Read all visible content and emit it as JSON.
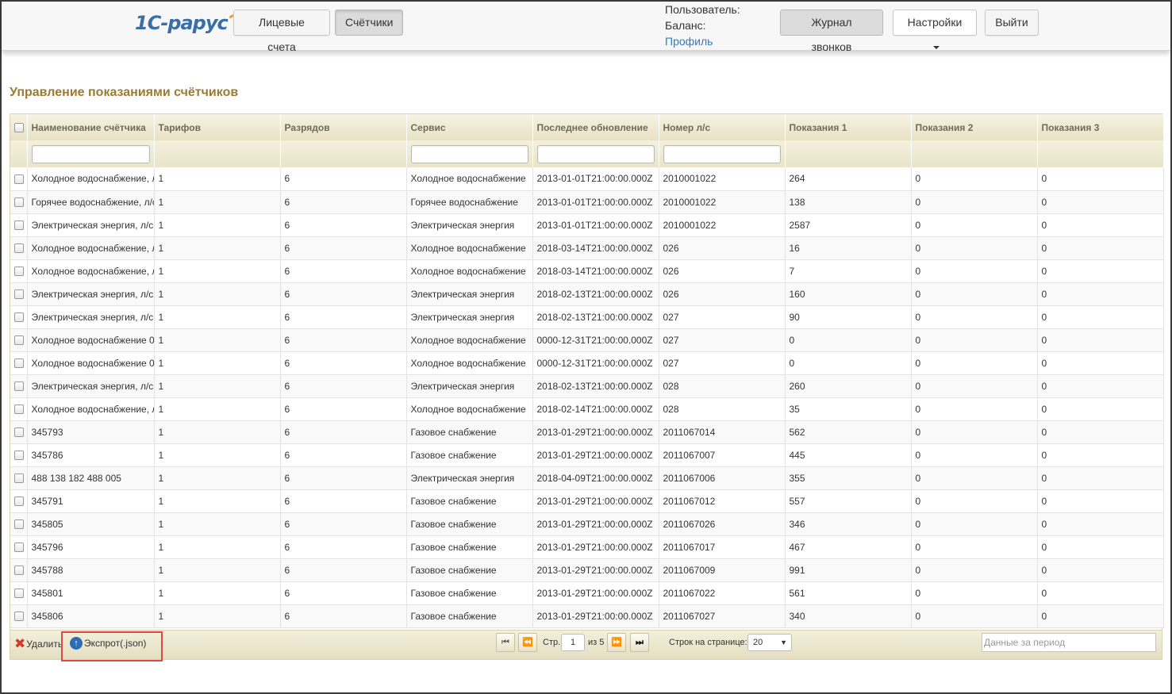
{
  "header": {
    "logo_text": "1С-рарус",
    "nav": [
      {
        "label": "Лицевые счета",
        "active": false
      },
      {
        "label": "Счётчики",
        "active": true
      }
    ],
    "user_label": "Пользователь:",
    "balance_label": "Баланс:",
    "profile_link": "Профиль",
    "call_log": "Журнал звонков",
    "settings": "Настройки",
    "logout": "Выйти"
  },
  "page": {
    "title": "Управление показаниями счётчиков"
  },
  "table": {
    "columns": [
      "Наименование счётчика",
      "Тарифов",
      "Разрядов",
      "Сервис",
      "Последнее обновление",
      "Номер л/с",
      "Показания 1",
      "Показания 2",
      "Показания 3"
    ],
    "rows": [
      [
        "Холодное водоснабжение, л/с",
        "1",
        "6",
        "Холодное водоснабжение",
        "2013-01-01T21:00:00.000Z",
        "2010001022",
        "264",
        "0",
        "0"
      ],
      [
        "Горячее водоснабжение, л/с",
        "1",
        "6",
        "Горячее водоснабжение",
        "2013-01-01T21:00:00.000Z",
        "2010001022",
        "138",
        "0",
        "0"
      ],
      [
        "Электрическая энергия, л/с",
        "1",
        "6",
        "Электрическая энергия",
        "2013-01-01T21:00:00.000Z",
        "2010001022",
        "2587",
        "0",
        "0"
      ],
      [
        "Холодное водоснабжение, л/с",
        "1",
        "6",
        "Холодное водоснабжение",
        "2018-03-14T21:00:00.000Z",
        "026",
        "16",
        "0",
        "0"
      ],
      [
        "Холодное водоснабжение, л/с",
        "1",
        "6",
        "Холодное водоснабжение",
        "2018-03-14T21:00:00.000Z",
        "026",
        "7",
        "0",
        "0"
      ],
      [
        "Электрическая энергия, л/с",
        "1",
        "6",
        "Электрическая энергия",
        "2018-02-13T21:00:00.000Z",
        "026",
        "160",
        "0",
        "0"
      ],
      [
        "Электрическая энергия, л/с",
        "1",
        "6",
        "Электрическая энергия",
        "2018-02-13T21:00:00.000Z",
        "027",
        "90",
        "0",
        "0"
      ],
      [
        "Холодное водоснабжение 0",
        "1",
        "6",
        "Холодное водоснабжение",
        "0000-12-31T21:00:00.000Z",
        "027",
        "0",
        "0",
        "0"
      ],
      [
        "Холодное водоснабжение 0",
        "1",
        "6",
        "Холодное водоснабжение",
        "0000-12-31T21:00:00.000Z",
        "027",
        "0",
        "0",
        "0"
      ],
      [
        "Электрическая энергия, л/с",
        "1",
        "6",
        "Электрическая энергия",
        "2018-02-13T21:00:00.000Z",
        "028",
        "260",
        "0",
        "0"
      ],
      [
        "Холодное водоснабжение, л/с",
        "1",
        "6",
        "Холодное водоснабжение",
        "2018-02-14T21:00:00.000Z",
        "028",
        "35",
        "0",
        "0"
      ],
      [
        "345793",
        "1",
        "6",
        "Газовое снабжение",
        "2013-01-29T21:00:00.000Z",
        "2011067014",
        "562",
        "0",
        "0"
      ],
      [
        "345786",
        "1",
        "6",
        "Газовое снабжение",
        "2013-01-29T21:00:00.000Z",
        "2011067007",
        "445",
        "0",
        "0"
      ],
      [
        "488 138 182 488 005",
        "1",
        "6",
        "Электрическая энергия",
        "2018-04-09T21:00:00.000Z",
        "2011067006",
        "355",
        "0",
        "0"
      ],
      [
        "345791",
        "1",
        "6",
        "Газовое снабжение",
        "2013-01-29T21:00:00.000Z",
        "2011067012",
        "557",
        "0",
        "0"
      ],
      [
        "345805",
        "1",
        "6",
        "Газовое снабжение",
        "2013-01-29T21:00:00.000Z",
        "2011067026",
        "346",
        "0",
        "0"
      ],
      [
        "345796",
        "1",
        "6",
        "Газовое снабжение",
        "2013-01-29T21:00:00.000Z",
        "2011067017",
        "467",
        "0",
        "0"
      ],
      [
        "345788",
        "1",
        "6",
        "Газовое снабжение",
        "2013-01-29T21:00:00.000Z",
        "2011067009",
        "991",
        "0",
        "0"
      ],
      [
        "345801",
        "1",
        "6",
        "Газовое снабжение",
        "2013-01-29T21:00:00.000Z",
        "2011067022",
        "561",
        "0",
        "0"
      ],
      [
        "345806",
        "1",
        "6",
        "Газовое снабжение",
        "2013-01-29T21:00:00.000Z",
        "2011067027",
        "340",
        "0",
        "0"
      ]
    ]
  },
  "footer": {
    "delete_label": "Удалить",
    "export_label": "Экспрот(.json)",
    "page_label": "Стр.",
    "page_current": "1",
    "page_of": "из 5",
    "rows_per_page_label": "Строк на странице:",
    "rows_per_page_value": "20",
    "period_placeholder": "Данные за период"
  },
  "colors": {
    "title": "#9b7b34",
    "link": "#3a78b5",
    "highlight_box": "#e04747"
  }
}
